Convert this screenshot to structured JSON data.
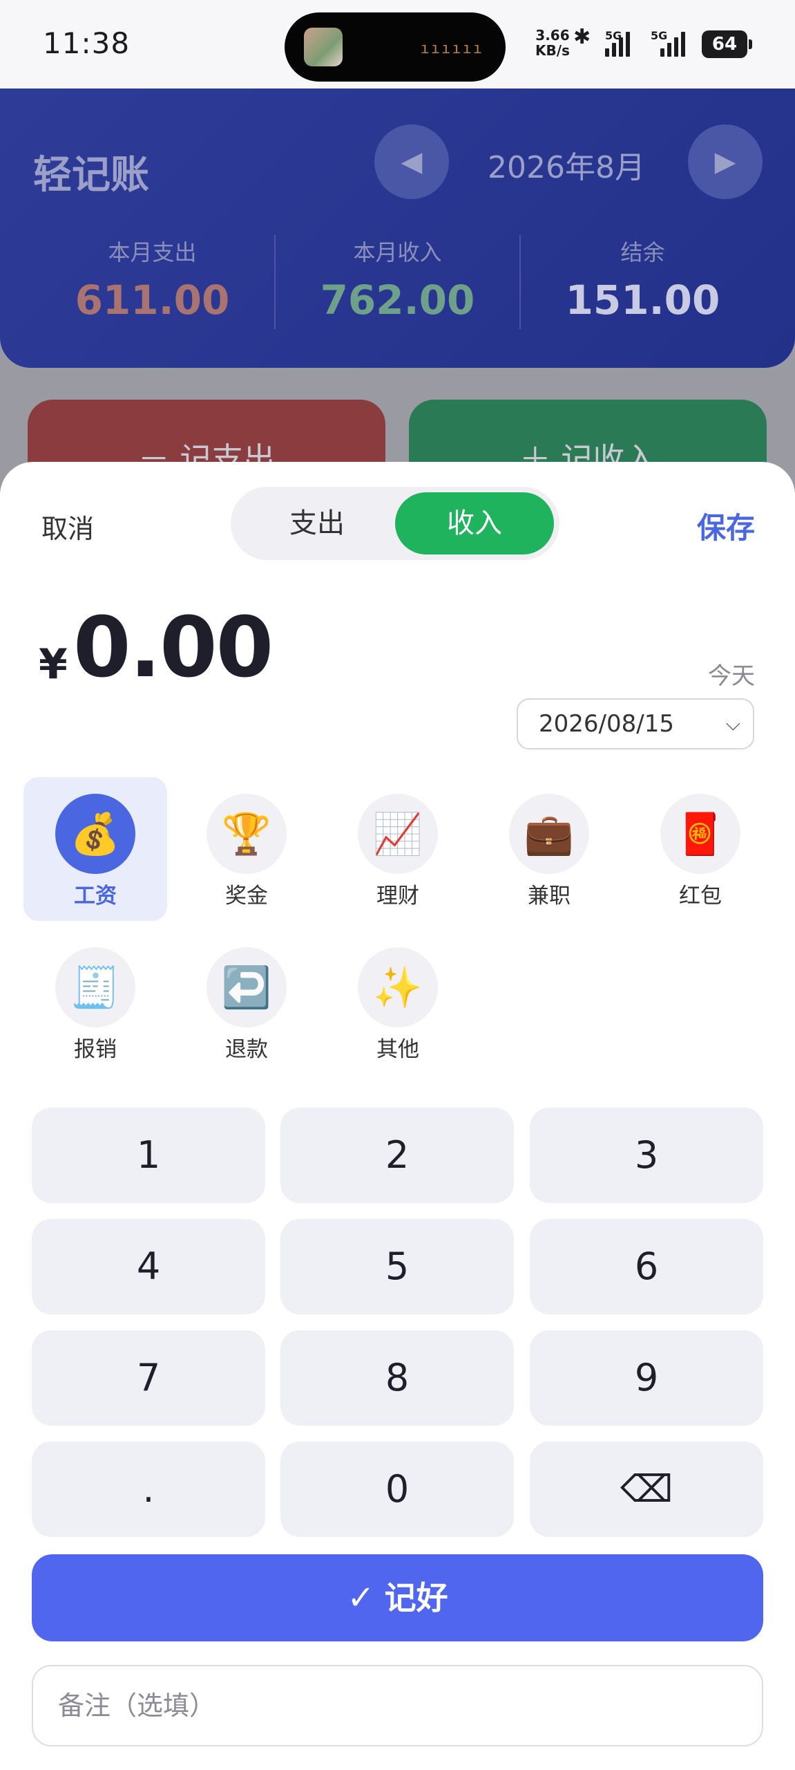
{
  "status_bar": {
    "time": "11:38",
    "net_speed_value": "3.66",
    "net_speed_unit": "KB/s",
    "net1": "5G",
    "net2": "5G",
    "battery": "64"
  },
  "header": {
    "title": "轻记账",
    "prev_icon": "◀",
    "next_icon": "▶",
    "month": "2026年8月",
    "stats": [
      {
        "label": "本月支出",
        "value": "611.00",
        "color": "#a9746f"
      },
      {
        "label": "本月收入",
        "value": "762.00",
        "color": "#6fa08a"
      },
      {
        "label": "结余",
        "value": "151.00",
        "color": "#c8cbe2"
      }
    ]
  },
  "background_buttons": {
    "expense": "－ 记支出",
    "income": "＋ 记收入"
  },
  "sheet": {
    "cancel": "取消",
    "save": "保存",
    "type_toggle": {
      "expense": "支出",
      "income": "收入",
      "selected": "收入"
    },
    "currency": "¥",
    "amount": "0.00",
    "date_hint": "今天",
    "date": "2026/08/15",
    "date_chevron": "⌵",
    "categories": [
      {
        "label": "工资",
        "icon": "💰",
        "icon_name": "money-bag-icon",
        "selected": true
      },
      {
        "label": "奖金",
        "icon": "🏆",
        "icon_name": "trophy-icon"
      },
      {
        "label": "理财",
        "icon": "📈",
        "icon_name": "chart-up-icon"
      },
      {
        "label": "兼职",
        "icon": "💼",
        "icon_name": "briefcase-icon"
      },
      {
        "label": "红包",
        "icon": "🧧",
        "icon_name": "red-envelope-icon"
      },
      {
        "label": "报销",
        "icon": "🧾",
        "icon_name": "receipt-icon"
      },
      {
        "label": "退款",
        "icon": "↩️",
        "icon_name": "return-arrow-icon"
      },
      {
        "label": "其他",
        "icon": "✨",
        "icon_name": "sparkles-icon"
      }
    ],
    "keypad": [
      "1",
      "2",
      "3",
      "4",
      "5",
      "6",
      "7",
      "8",
      "9",
      ".",
      "0",
      "⌫"
    ],
    "confirm_icon": "✓",
    "confirm_label": "记好",
    "note_placeholder": "备注（选填）",
    "accent_color": "#5066ee",
    "income_color": "#1fb35e"
  }
}
